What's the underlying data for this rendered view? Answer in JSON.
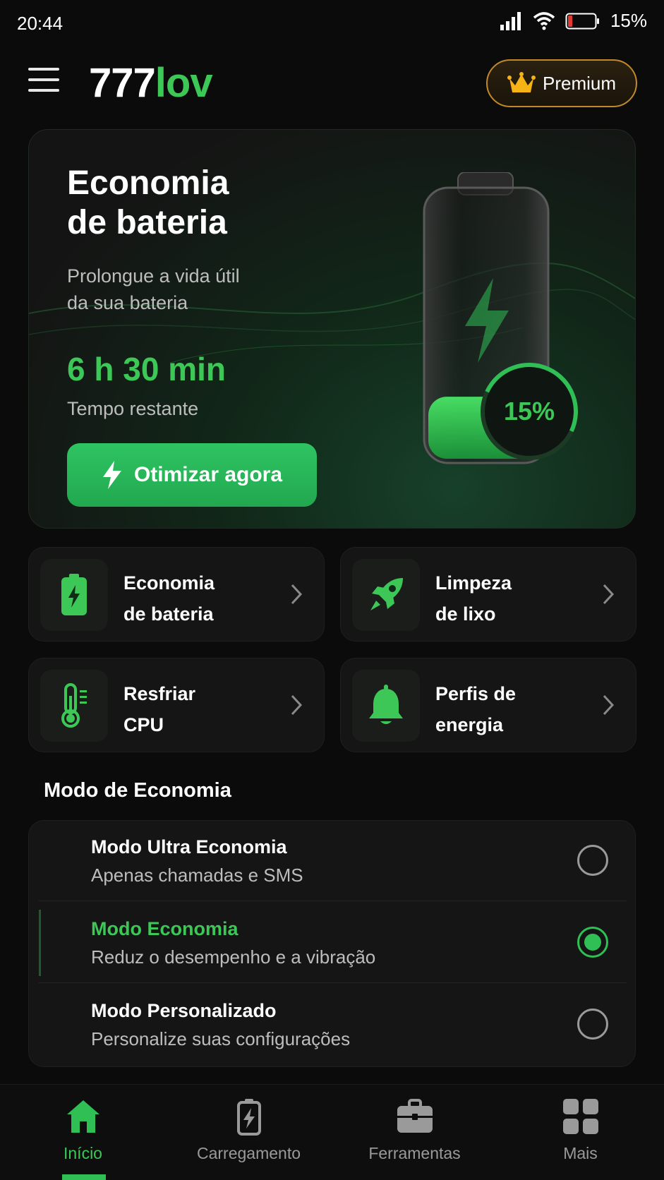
{
  "status_bar": {
    "time": "20:44",
    "battery_percent": "15%"
  },
  "header": {
    "logo_part1": "777",
    "logo_part2": "lov",
    "premium_label": "Premium"
  },
  "hero": {
    "title_line1": "Economia",
    "title_line2": "de bateria",
    "subtitle_line1": "Prolongue a vida útil",
    "subtitle_line2": "da sua bateria",
    "time_remaining": "6 h 30 min",
    "time_label": "Tempo restante",
    "optimize_label": "Otimizar agora",
    "battery_level_text": "15%",
    "battery_level": 0.15
  },
  "tiles": [
    {
      "line1": "Economia",
      "line2": "de bateria",
      "icon": "battery-icon"
    },
    {
      "line1": "Limpeza",
      "line2": "de lixo",
      "icon": "rocket-icon"
    },
    {
      "line1": "Resfriar",
      "line2": "CPU",
      "icon": "thermometer-icon"
    },
    {
      "line1": "Perfis de",
      "line2": "energia",
      "icon": "bell-icon"
    }
  ],
  "modes": {
    "section_title": "Modo de Economia",
    "items": [
      {
        "title": "Modo Ultra Economia",
        "desc": "Apenas chamadas e SMS",
        "selected": false
      },
      {
        "title": "Modo Economia",
        "desc": "Reduz o desempenho e a vibração",
        "selected": true
      },
      {
        "title": "Modo Personalizado",
        "desc": "Personalize suas configurações",
        "selected": false
      }
    ]
  },
  "nav": {
    "items": [
      {
        "label": "Início",
        "icon": "home-icon",
        "active": true
      },
      {
        "label": "Carregamento",
        "icon": "charging-icon",
        "active": false
      },
      {
        "label": "Ferramentas",
        "icon": "toolbox-icon",
        "active": false
      },
      {
        "label": "Mais",
        "icon": "grid-icon",
        "active": false
      }
    ]
  },
  "colors": {
    "accent": "#3cc756",
    "background": "#0b0b0b",
    "card": "#151515",
    "premium_border": "#c08a2a"
  }
}
